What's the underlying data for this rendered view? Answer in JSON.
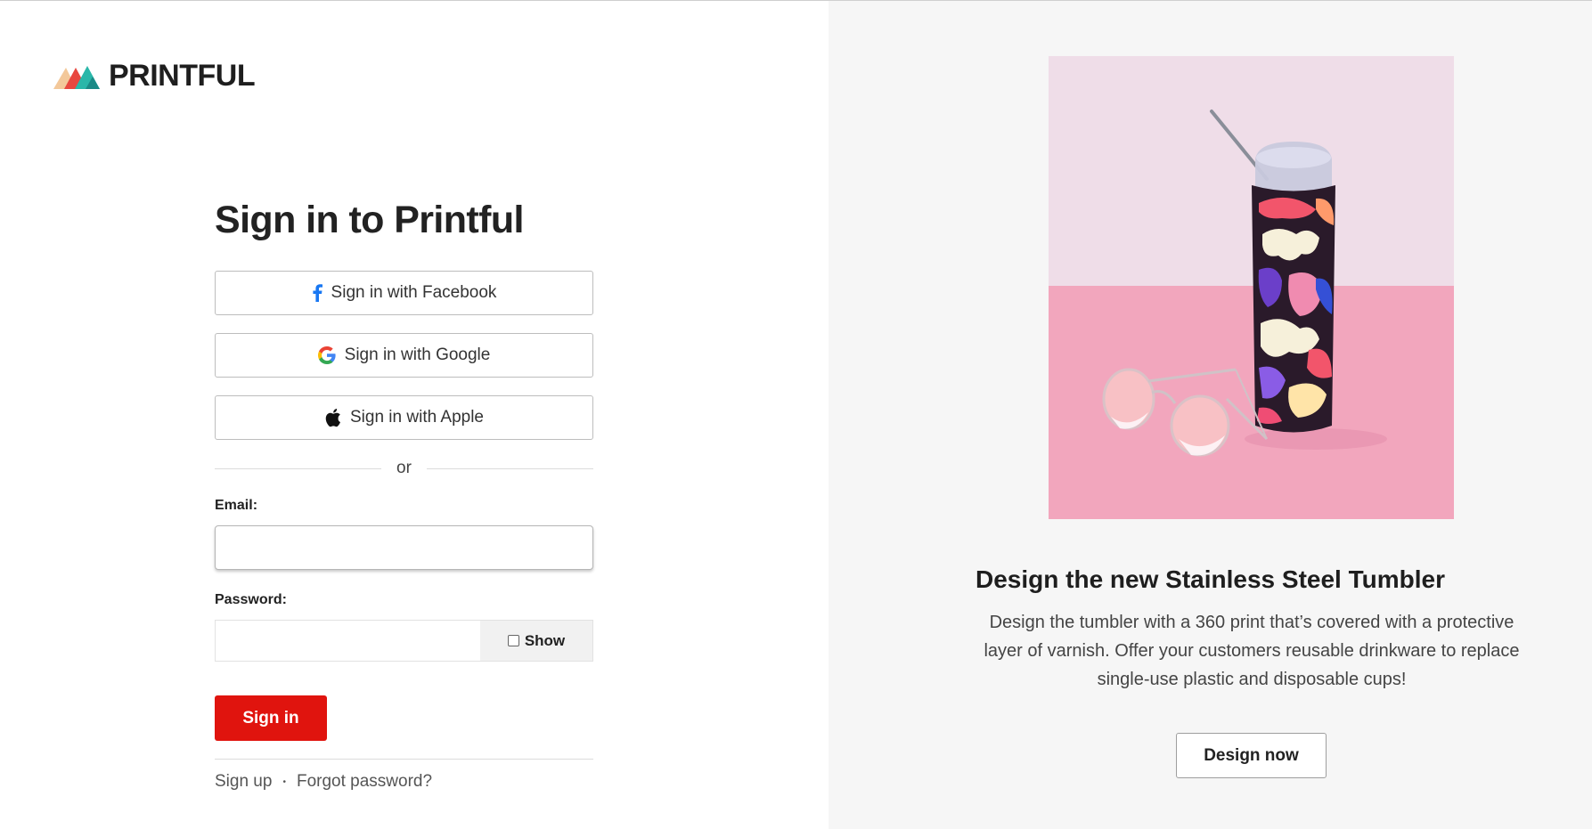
{
  "brand": {
    "name": "PRINTFUL"
  },
  "signin": {
    "title": "Sign in to Printful",
    "facebook_label": "Sign in with Facebook",
    "google_label": "Sign in with Google",
    "apple_label": "Sign in with Apple",
    "or_text": "or",
    "email_label": "Email:",
    "email_value": "",
    "password_label": "Password:",
    "password_value": "",
    "show_label": "Show",
    "submit_label": "Sign in",
    "signup_link": "Sign up",
    "separator": "•",
    "forgot_link": "Forgot password?"
  },
  "promo": {
    "title": "Design the new Stainless Steel Tumbler",
    "description": "Design the tumbler with a 360 print that’s covered with a protective layer of varnish. Offer your customers reusable drinkware to replace single-use plastic and disposable cups!",
    "cta_label": "Design now"
  },
  "colors": {
    "primary_button": "#e0140e",
    "right_panel_bg": "#f6f6f6",
    "facebook": "#1877f2"
  }
}
